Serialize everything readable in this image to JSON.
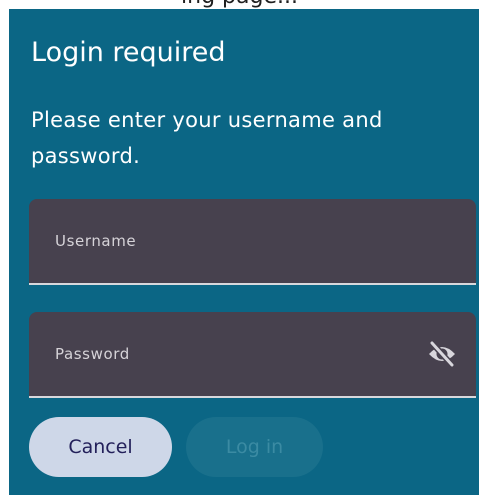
{
  "background": {
    "partial_text": "ing page..."
  },
  "dialog": {
    "title": "Login required",
    "message": "Please enter your username and password.",
    "username_field": {
      "label": "Username",
      "value": ""
    },
    "password_field": {
      "label": "Password",
      "value": "",
      "toggle_icon": "visibility-off-icon"
    },
    "buttons": {
      "cancel_label": "Cancel",
      "login_label": "Log in"
    }
  },
  "colors": {
    "dialog_background": "#0b6685",
    "field_background": "#47414e",
    "cancel_button": "#ced7e8",
    "login_button_disabled": "#19708c"
  }
}
